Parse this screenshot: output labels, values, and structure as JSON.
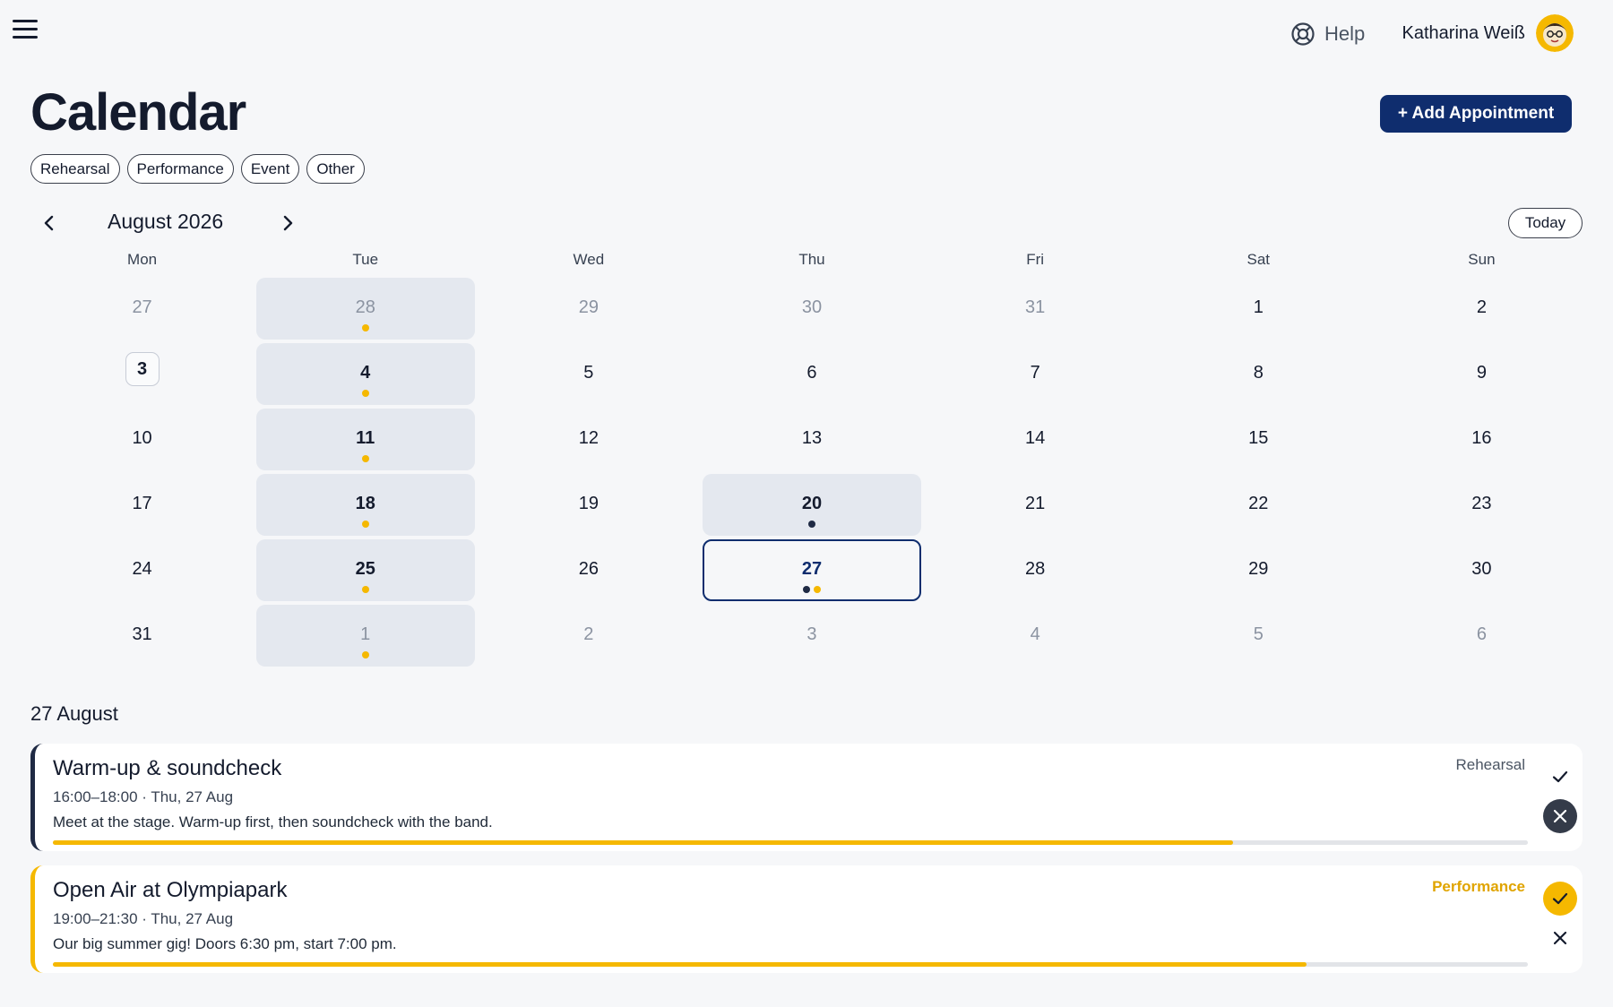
{
  "header": {
    "help_label": "Help",
    "user_name": "Katharina Weiß"
  },
  "page": {
    "title": "Calendar",
    "add_button_label": "+ Add Appointment"
  },
  "filters": [
    "Rehearsal",
    "Performance",
    "Event",
    "Other"
  ],
  "calendar": {
    "month_label": "August 2026",
    "today_label": "Today",
    "weekdays": [
      "Mon",
      "Tue",
      "Wed",
      "Thu",
      "Fri",
      "Sat",
      "Sun"
    ],
    "weeks": [
      [
        {
          "d": "27",
          "muted": true
        },
        {
          "d": "28",
          "muted": true,
          "hl": true,
          "dots": [
            "performance"
          ]
        },
        {
          "d": "29",
          "muted": true
        },
        {
          "d": "30",
          "muted": true
        },
        {
          "d": "31",
          "muted": true
        },
        {
          "d": "1"
        },
        {
          "d": "2"
        }
      ],
      [
        {
          "d": "3",
          "today": true
        },
        {
          "d": "4",
          "hl": true,
          "dots": [
            "performance"
          ]
        },
        {
          "d": "5"
        },
        {
          "d": "6"
        },
        {
          "d": "7"
        },
        {
          "d": "8"
        },
        {
          "d": "9"
        }
      ],
      [
        {
          "d": "10"
        },
        {
          "d": "11",
          "hl": true,
          "dots": [
            "performance"
          ]
        },
        {
          "d": "12"
        },
        {
          "d": "13"
        },
        {
          "d": "14"
        },
        {
          "d": "15"
        },
        {
          "d": "16"
        }
      ],
      [
        {
          "d": "17"
        },
        {
          "d": "18",
          "hl": true,
          "dots": [
            "performance"
          ]
        },
        {
          "d": "19"
        },
        {
          "d": "20",
          "hl": true,
          "dots": [
            "rehearsal"
          ]
        },
        {
          "d": "21"
        },
        {
          "d": "22"
        },
        {
          "d": "23"
        }
      ],
      [
        {
          "d": "24"
        },
        {
          "d": "25",
          "hl": true,
          "dots": [
            "performance"
          ]
        },
        {
          "d": "26"
        },
        {
          "d": "27",
          "selected": true,
          "dots": [
            "rehearsal",
            "performance"
          ]
        },
        {
          "d": "28"
        },
        {
          "d": "29"
        },
        {
          "d": "30"
        }
      ],
      [
        {
          "d": "31"
        },
        {
          "d": "1",
          "muted": true,
          "hl": true,
          "dots": [
            "performance"
          ]
        },
        {
          "d": "2",
          "muted": true
        },
        {
          "d": "3",
          "muted": true
        },
        {
          "d": "4",
          "muted": true
        },
        {
          "d": "5",
          "muted": true
        },
        {
          "d": "6",
          "muted": true
        }
      ]
    ]
  },
  "colors": {
    "brand": "#0f2d6e",
    "rehearsal": "#1f2a44",
    "performance": "#f5b800",
    "highlight": "#e4e8ef"
  },
  "selected_day": {
    "title": "27 August",
    "appointments": [
      {
        "title": "Warm-up & soundcheck",
        "time": "16:00–18:00 · Thu, 27 Aug",
        "description": "Meet at the stage. Warm-up first, then soundcheck with the band.",
        "category": "Rehearsal",
        "progress": 0.8,
        "status": "declined"
      },
      {
        "title": "Open Air at Olympiapark",
        "time": "19:00–21:30 · Thu, 27 Aug",
        "description": "Our big summer gig! Doors 6:30 pm, start 7:00 pm.",
        "category": "Performance",
        "progress": 0.85,
        "status": "accepted"
      }
    ]
  },
  "icons": [
    "menu-icon",
    "lifebuoy-icon",
    "avatar",
    "chevron-left-icon",
    "chevron-right-icon",
    "check-icon",
    "close-icon"
  ]
}
